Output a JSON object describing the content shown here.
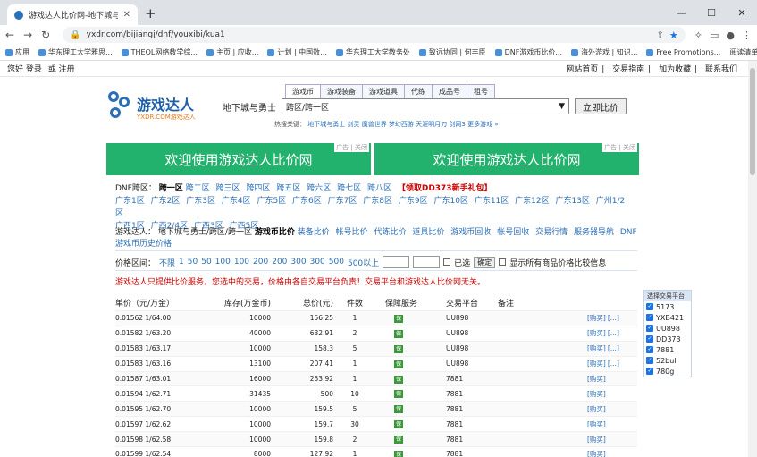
{
  "browser": {
    "tab_title": "游戏达人比价网-地下城与勇士DNF",
    "url": "yxdr.com/bijiangj/dnf/youxibi/kua1",
    "bookmarks": [
      "应用",
      "华东理工大学雅思...",
      "THEOL网络教学综...",
      "主页 | 应收...",
      "计划 | 中国数...",
      "华东理工大学教务处",
      "致远协同 | 何丰臣",
      "DNF游戏币比价...",
      "海外游戏 | 知识...",
      "Free Promotions..."
    ],
    "bookmarks_right": "阅读清单"
  },
  "topbar": {
    "greeting": "您好",
    "login": "登录",
    "or": "或",
    "register": "注册",
    "right_links": [
      "网站首页",
      "交易指南",
      "加为收藏",
      "联系我们"
    ]
  },
  "header": {
    "logo_text": "游戏达人",
    "logo_sub": "YXDR.COM游戏达人",
    "search_tabs": [
      "游戏币",
      "游戏装备",
      "游戏道具",
      "代练",
      "成品号",
      "租号"
    ],
    "search_label": "地下城与勇士",
    "search_value": "跨区/跨一区",
    "search_button": "立即比价",
    "hot_prefix": "热搜关键：",
    "hot_links": [
      "地下城与勇士",
      "剑灵",
      "魔兽世界",
      "梦幻西游",
      "天涯明月刀",
      "剑网3",
      "更多游戏 »"
    ]
  },
  "banners": [
    {
      "text": "欢迎使用游戏达人比价网",
      "ad": "广告 | 关闭"
    },
    {
      "text": "欢迎使用游戏达人比价网",
      "ad": "广告 | 关闭"
    }
  ],
  "zones": {
    "label": "DNF跨区：",
    "current": "跨一区",
    "row1": [
      "跨二区",
      "跨三区",
      "跨四区",
      "跨五区",
      "跨六区",
      "跨七区",
      "跨八区"
    ],
    "gift": "【领取DD373新手礼包】",
    "row2": [
      "广东1区",
      "广东2区",
      "广东3区",
      "广东4区",
      "广东5区",
      "广东6区",
      "广东7区",
      "广东8区",
      "广东9区",
      "广东10区",
      "广东11区",
      "广东12区",
      "广东13区",
      "广州1/2区"
    ],
    "row3": [
      "广西1区",
      "广西2/4区",
      "广西3区",
      "广西5区"
    ]
  },
  "crumb": {
    "prefix": "游戏达人：",
    "path": "地下城与勇士/跨区/跨一区",
    "current": "游戏币比价",
    "links": [
      "装备比价",
      "帐号比价",
      "代练比价",
      "道具比价",
      "游戏币回收",
      "帐号回收",
      "交易行情",
      "服务器导航"
    ],
    "extra": "DNF游戏币历史价格"
  },
  "prices": {
    "label": "价格区间：",
    "options": [
      "不限",
      "1",
      "50",
      "50",
      "100",
      "100",
      "200",
      "200",
      "300",
      "300",
      "500",
      "500以上"
    ],
    "check1": "已选",
    "go": "确定",
    "check2": "显示所有商品价格比较信息"
  },
  "notice": "游戏达人只提供比价服务，您选中的交易，价格由各自交易平台负责！交易平台和游戏达人比价网无关。",
  "table": {
    "headers": [
      "单价（元/万金）",
      "库存(万金币)",
      "总价(元)",
      "件数",
      "保障服务",
      "交易平台",
      "备注",
      "",
      ""
    ],
    "rows": [
      [
        "0.01562 1/64.00",
        "10000",
        "156.25",
        "1",
        "保",
        "UU898",
        "",
        "[购买]",
        "[...]"
      ],
      [
        "0.01582 1/63.20",
        "40000",
        "632.91",
        "2",
        "保",
        "UU898",
        "",
        "[购买]",
        "[...]"
      ],
      [
        "0.01583 1/63.17",
        "10000",
        "158.3",
        "5",
        "保",
        "UU898",
        "",
        "[购买]",
        "[...]"
      ],
      [
        "0.01583 1/63.16",
        "13100",
        "207.41",
        "1",
        "保",
        "UU898",
        "",
        "[购买]",
        "[...]"
      ],
      [
        "0.01587 1/63.01",
        "16000",
        "253.92",
        "1",
        "保",
        "7881",
        "",
        "[购买]",
        ""
      ],
      [
        "0.01594 1/62.71",
        "31435",
        "500",
        "10",
        "保",
        "7881",
        "",
        "[购买]",
        ""
      ],
      [
        "0.01595 1/62.70",
        "10000",
        "159.5",
        "5",
        "保",
        "7881",
        "",
        "[购买]",
        ""
      ],
      [
        "0.01597 1/62.62",
        "10000",
        "159.7",
        "30",
        "保",
        "7881",
        "",
        "[购买]",
        ""
      ],
      [
        "0.01598 1/62.58",
        "10000",
        "159.8",
        "2",
        "保",
        "7881",
        "",
        "[购买]",
        ""
      ],
      [
        "0.01599 1/62.54",
        "8000",
        "127.92",
        "1",
        "保",
        "7881",
        "",
        "[购买]",
        ""
      ]
    ]
  },
  "side_filter": {
    "header": "选择交易平台",
    "items": [
      "5173",
      "YXB421",
      "UU898",
      "DD373",
      "7881",
      "52bull",
      "780g"
    ]
  }
}
